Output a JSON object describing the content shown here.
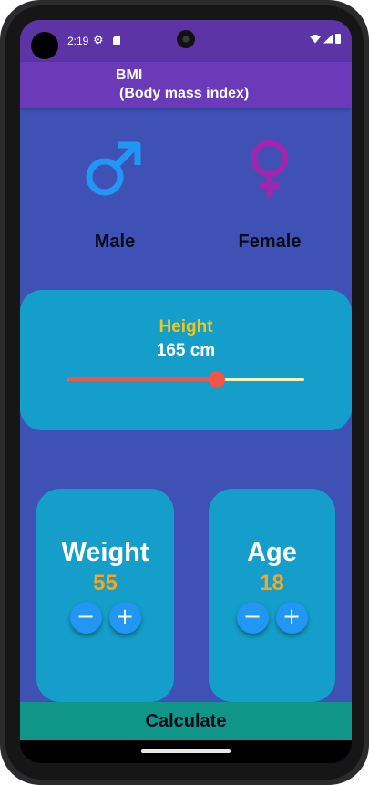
{
  "status_bar": {
    "time": "2:19",
    "icons": [
      "settings-icon",
      "sd-card-icon",
      "wifi-icon",
      "signal-icon",
      "battery-icon"
    ]
  },
  "app_bar": {
    "title_line1": "BMI",
    "title_line2": "(Body mass index)"
  },
  "gender": {
    "male": {
      "label": "Male",
      "icon": "male-symbol-icon",
      "color": "#2196f3"
    },
    "female": {
      "label": "Female",
      "icon": "female-symbol-icon",
      "color": "#9c27b0"
    }
  },
  "height": {
    "label": "Height",
    "value_text": "165 cm",
    "slider_fraction": 0.63
  },
  "weight": {
    "label": "Weight",
    "value": "55",
    "decrement": "−",
    "increment": "+"
  },
  "age": {
    "label": "Age",
    "value": "18",
    "decrement": "−",
    "increment": "+"
  },
  "calculate_label": "Calculate",
  "colors": {
    "background": "#3f51b5",
    "app_bar": "#6a3ab8",
    "card": "#149ec9",
    "accent_yellow": "#f5c518",
    "accent_orange": "#f5a623",
    "slider_active": "#f05545",
    "calculate_bar": "#0f9688"
  }
}
